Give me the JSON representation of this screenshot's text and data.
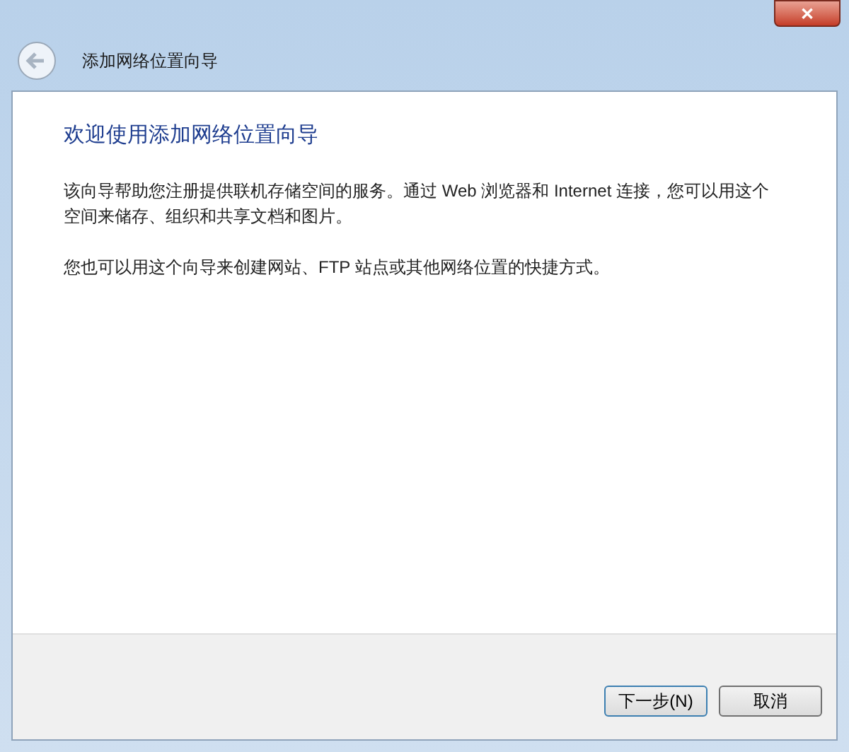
{
  "window": {
    "title": "添加网络位置向导",
    "close": "✕"
  },
  "content": {
    "heading": "欢迎使用添加网络位置向导",
    "paragraphs": [
      "该向导帮助您注册提供联机存储空间的服务。通过 Web 浏览器和 Internet 连接，您可以用这个空间来储存、组织和共享文档和图片。",
      "您也可以用这个向导来创建网站、FTP 站点或其他网络位置的快捷方式。"
    ]
  },
  "buttons": [
    {
      "label": "下一步(N)",
      "default": true
    },
    {
      "label": "取消",
      "default": false
    }
  ]
}
